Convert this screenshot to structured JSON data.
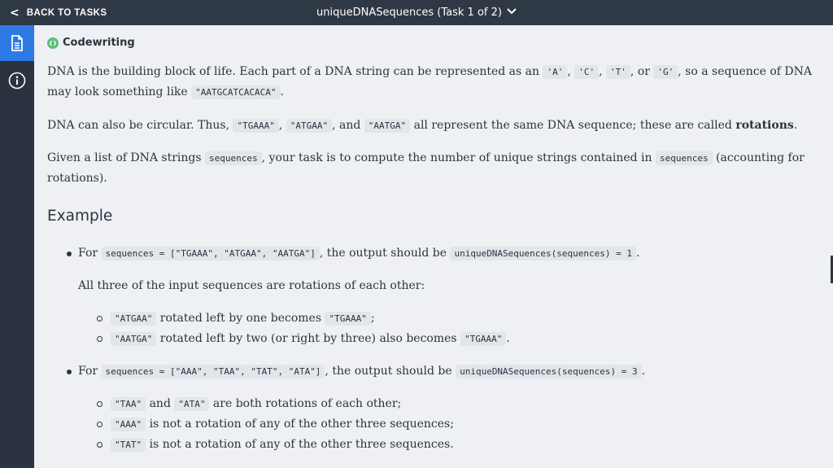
{
  "topbar": {
    "back_label": "BACK TO TASKS",
    "title": "uniqueDNASequences (Task 1 of 2)"
  },
  "sidebar": {
    "items": [
      {
        "icon": "document-icon",
        "active": true
      },
      {
        "icon": "info-icon",
        "active": false
      }
    ]
  },
  "section_label": "Codewriting",
  "intro": {
    "p1": [
      "DNA is the building block of life. Each part of a DNA string can be represented as an ",
      "'A'",
      ", ",
      "'C'",
      ", ",
      "'T'",
      ", or ",
      "'G'",
      ", so a sequence of DNA may look something like ",
      "\"AATGCATCACACA\"",
      "."
    ],
    "p2": [
      "DNA can also be circular. Thus, ",
      "\"TGAAA\"",
      ", ",
      "\"ATGAA\"",
      ", and ",
      "\"AATGA\"",
      " all represent the same DNA sequence; these are called ",
      "rotations",
      "."
    ],
    "p3": [
      "Given a list of DNA strings ",
      "sequences",
      ", your task is to compute the number of unique strings contained in ",
      "sequences",
      " (accounting for rotations)."
    ]
  },
  "example_heading": "Example",
  "examples": {
    "ex1": {
      "t1": "For ",
      "code1": "sequences = [\"TGAAA\", \"ATGAA\", \"AATGA\"]",
      "t2": ", the output should be ",
      "code2": "uniqueDNASequences(sequences) = 1",
      "t3": ".",
      "note": "All three of the input sequences are rotations of each other:",
      "sub1": {
        "c1": "\"ATGAA\"",
        "t1": " rotated left by one becomes ",
        "c2": "\"TGAAA\"",
        "t2": ";"
      },
      "sub2": {
        "c1": "\"AATGA\"",
        "t1": " rotated left by two (or right by three) also becomes ",
        "c2": "\"TGAAA\"",
        "t2": "."
      }
    },
    "ex2": {
      "t1": "For ",
      "code1": "sequences = [\"AAA\", \"TAA\", \"TAT\", \"ATA\"]",
      "t2": ", the output should be ",
      "code2": "uniqueDNASequences(sequences) = 3",
      "t3": ".",
      "sub1": {
        "c1": "\"TAA\"",
        "t1": " and ",
        "c2": "\"ATA\"",
        "t2": " are both rotations of each other;"
      },
      "sub2": {
        "c1": "\"AAA\"",
        "t1": " is not a rotation of any of the other three sequences;"
      },
      "sub3": {
        "c1": "\"TAT\"",
        "t1": " is not a rotation of any of the other three sequences."
      }
    }
  },
  "colors": {
    "topbar": "#2f3845",
    "sidebar": "#2b3340",
    "active": "#2d7ae5",
    "background": "#eef0f3",
    "code_bg": "#e2e5ea",
    "codewriting_icon": "#5bbf7a"
  }
}
